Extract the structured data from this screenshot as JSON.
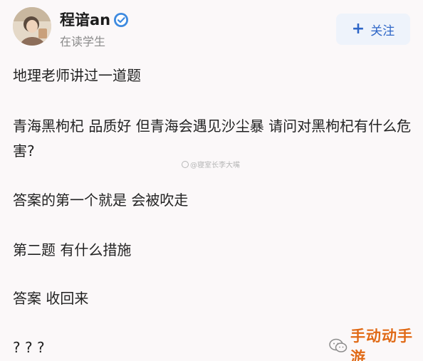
{
  "header": {
    "username": "程谙an",
    "subtitle": "在读学生",
    "follow_label": "关注",
    "verified_icon": "verified-badge-icon"
  },
  "post": {
    "lines": [
      "地理老师讲过一道题",
      "青海黑枸杞 品质好 但青海会遇见沙尘暴 请问对黑枸杞有什么危害?",
      "答案的第一个就是 会被吹走",
      "第二题 有什么措施",
      "答案 收回来",
      "? ? ?"
    ]
  },
  "watermarks": {
    "center": "@寝室长李大嘴",
    "corner": "手动动手游"
  },
  "colors": {
    "background": "#fbf8f9",
    "accent": "#2e66c7",
    "follow_bg": "#eef3fb",
    "corner_watermark": "#e06a17"
  }
}
